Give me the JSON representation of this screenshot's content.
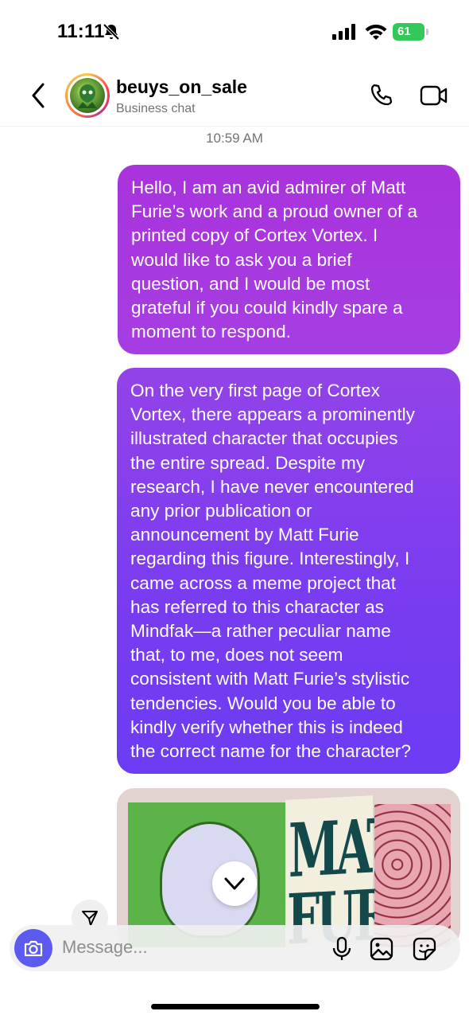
{
  "status_bar": {
    "time": "11:11",
    "battery_level": "61"
  },
  "header": {
    "username": "beuys_on_sale",
    "subtitle": "Business chat"
  },
  "thread": {
    "timestamp": "10:59 AM",
    "messages": [
      {
        "lines": [
          "Hello, I am an avid admirer of Matt",
          "Furie’s work and a proud owner of a",
          "printed copy of Cortex Vortex. I",
          "would like to ask you a brief",
          "question, and I would be most",
          "grateful if you could kindly spare a",
          "moment to respond."
        ]
      },
      {
        "lines": [
          "On the very first page of Cortex",
          "Vortex, there appears a prominently",
          "illustrated character that occupies",
          "the entire spread. Despite my",
          "research, I have never encountered",
          "any prior publication or",
          "announcement by Matt Furie",
          "regarding this figure. Interestingly, I",
          "came across a meme project that",
          "has referred to this character as",
          "Mindfak—a rather peculiar name",
          "that, to me, does not seem",
          "consistent with Matt Furie’s stylistic",
          "tendencies. Would you be able to",
          "kindly verify whether this is indeed",
          "the correct name for the character?"
        ]
      }
    ],
    "photo_text": {
      "line1": "MATT",
      "line2": "FURIE"
    }
  },
  "composer": {
    "placeholder": "Message..."
  },
  "icons": {
    "back": "chevron-left-icon",
    "call": "phone-icon",
    "video": "video-camera-icon",
    "camera": "camera-icon",
    "mic": "microphone-icon",
    "gallery": "gallery-icon",
    "sticker": "sticker-icon",
    "share": "paper-plane-icon",
    "scroll": "chevron-down-icon"
  },
  "colors": {
    "bubble_top": "#a933dc",
    "bubble_bottom": "#6c3cf2",
    "camera_button": "#5b5bf0",
    "battery": "#34c759"
  }
}
